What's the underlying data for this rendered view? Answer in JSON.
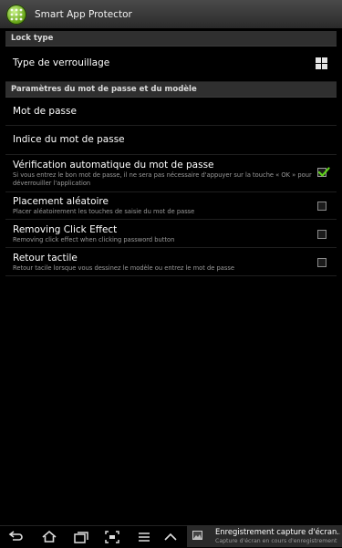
{
  "app": {
    "title": "Smart App Protector",
    "icon": "app-logo-icon"
  },
  "sections": {
    "lock": {
      "header": "Lock type",
      "lock_type_label": "Type de verrouillage",
      "lock_type_icon": "pattern-grid-icon"
    },
    "password": {
      "header": "Paramètres du mot de passe et du modèle",
      "password_label": "Mot de passe",
      "hint_label": "Indice du mot de passe",
      "autoverify": {
        "title": "Vérification automatique du mot de passe",
        "summary": "Si vous entrez le bon mot de passe, il ne sera pas nécessaire d'appuyer sur la touche « OK » pour déverrouiller l'application",
        "checked": true
      },
      "random": {
        "title": "Placement aléatoire",
        "summary": "Placer aléatoirement les touches de saisie du mot de passe",
        "checked": false
      },
      "click_effect": {
        "title": "Removing Click Effect",
        "summary": "Removing click effect when clicking password button",
        "checked": false
      },
      "haptic": {
        "title": "Retour tactile",
        "summary": "Retour tacile lorsque vous dessinez le modèle ou entrez le mot de passe",
        "checked": false
      }
    }
  },
  "navbar": {
    "buttons": [
      "back-icon",
      "home-icon",
      "recent-apps-icon",
      "screenshot-icon",
      "menu-icon",
      "chevron-up-icon"
    ]
  },
  "notification": {
    "title": "Enregistrement capture d'écran...",
    "subtitle": "Capture d'écran en cours d'enregistrement",
    "icon": "image-icon"
  }
}
